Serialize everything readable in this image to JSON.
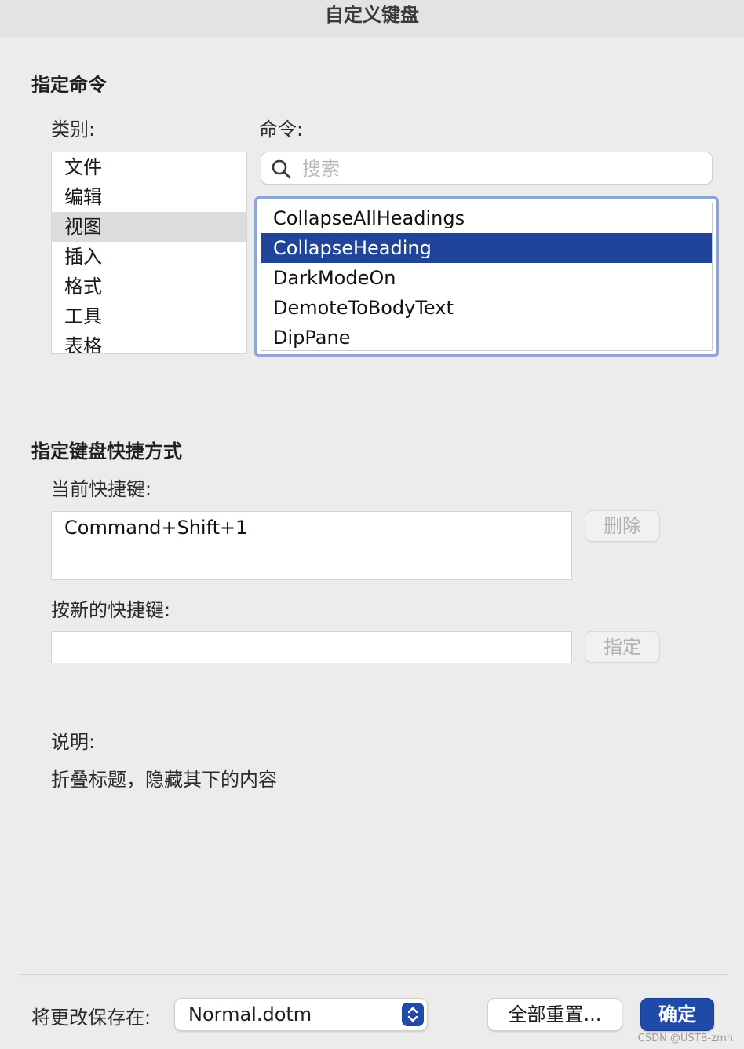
{
  "window": {
    "title": "自定义键盘"
  },
  "assign_command": {
    "section_title": "指定命令",
    "categories_label": "类别:",
    "categories": [
      {
        "label": "文件",
        "selected": false
      },
      {
        "label": "编辑",
        "selected": false
      },
      {
        "label": "视图",
        "selected": true
      },
      {
        "label": "插入",
        "selected": false
      },
      {
        "label": "格式",
        "selected": false
      },
      {
        "label": "工具",
        "selected": false
      },
      {
        "label": "表格",
        "selected": false
      }
    ],
    "commands_label": "命令:",
    "search": {
      "placeholder": "搜索",
      "value": ""
    },
    "commands": [
      {
        "label": "CollapseAllHeadings",
        "selected": false
      },
      {
        "label": "CollapseHeading",
        "selected": true
      },
      {
        "label": "DarkModeOn",
        "selected": false
      },
      {
        "label": "DemoteToBodyText",
        "selected": false
      },
      {
        "label": "DipPane",
        "selected": false
      }
    ]
  },
  "shortcut": {
    "section_title": "指定键盘快捷方式",
    "current_label": "当前快捷键:",
    "current_value": "Command+Shift+1",
    "delete_button": "删除",
    "new_label": "按新的快捷键:",
    "new_value": "",
    "assign_button": "指定"
  },
  "description": {
    "label": "说明:",
    "text": "折叠标题，隐藏其下的内容"
  },
  "footer": {
    "save_in_label": "将更改保存在:",
    "save_in_value": "Normal.dotm",
    "reset_all_button": "全部重置...",
    "ok_button": "确定"
  },
  "watermark": "CSDN @USTB-zmh",
  "colors": {
    "accent": "#1f449a",
    "focus_ring": "#8ea5d8"
  }
}
